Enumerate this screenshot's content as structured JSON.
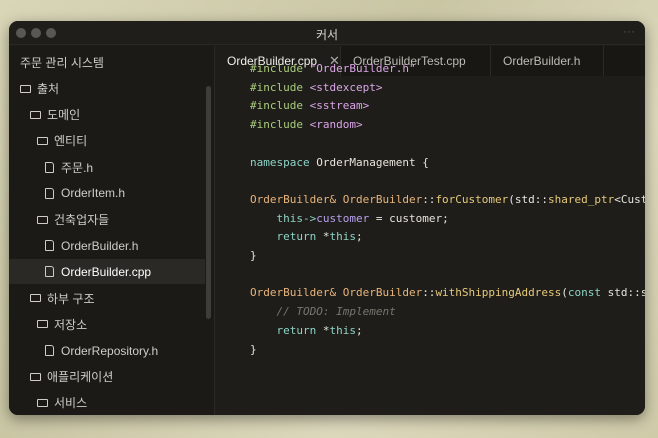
{
  "window": {
    "title": "커서"
  },
  "sidebar": {
    "header": "주문 관리 시스템",
    "items": [
      {
        "label": "출처",
        "type": "folder",
        "level": 0
      },
      {
        "label": "도메인",
        "type": "folder",
        "level": 1
      },
      {
        "label": "엔티티",
        "type": "folder",
        "level": 2
      },
      {
        "label": "주문.h",
        "type": "file",
        "level": 3
      },
      {
        "label": "OrderItem.h",
        "type": "file",
        "level": 3
      },
      {
        "label": "건축업자들",
        "type": "folder",
        "level": 2
      },
      {
        "label": "OrderBuilder.h",
        "type": "file",
        "level": 3
      },
      {
        "label": "OrderBuilder.cpp",
        "type": "file",
        "level": 3,
        "selected": true
      },
      {
        "label": "하부 구조",
        "type": "folder",
        "level": 1
      },
      {
        "label": "저장소",
        "type": "folder",
        "level": 2
      },
      {
        "label": "OrderRepository.h",
        "type": "file",
        "level": 3
      },
      {
        "label": "애플리케이션",
        "type": "folder",
        "level": 1
      },
      {
        "label": "서비스",
        "type": "folder",
        "level": 2
      }
    ]
  },
  "tabs": [
    {
      "label": "OrderBuilder.cpp",
      "active": true
    },
    {
      "label": "OrderBuilderTest.cpp"
    },
    {
      "label": "OrderBuilder.h"
    }
  ],
  "code": [
    [
      [
        "inc",
        "#include "
      ],
      [
        "str",
        "\"OrderBuilder.h\""
      ]
    ],
    [
      [
        "inc",
        "#include "
      ],
      [
        "str",
        "<stdexcept>"
      ]
    ],
    [
      [
        "inc",
        "#include "
      ],
      [
        "str",
        "<sstream>"
      ]
    ],
    [
      [
        "inc",
        "#include "
      ],
      [
        "str",
        "<random>"
      ]
    ],
    [],
    [
      [
        "kw",
        "namespace "
      ],
      [
        "",
        "OrderManagement {"
      ]
    ],
    [],
    [
      [
        "ty",
        "OrderBuilder& OrderBuilder"
      ],
      [
        "",
        "::"
      ],
      [
        "fn",
        "forCustomer"
      ],
      [
        "",
        "(std::"
      ],
      [
        "fn",
        "shared_ptr"
      ],
      [
        "",
        "<Customer> customer) {"
      ]
    ],
    [
      [
        "",
        "    "
      ],
      [
        "kw",
        "this->"
      ],
      [
        "mem",
        "customer"
      ],
      [
        "",
        " = customer;"
      ]
    ],
    [
      [
        "",
        "    "
      ],
      [
        "kw",
        "return "
      ],
      [
        "",
        "*"
      ],
      [
        "kw",
        "this"
      ],
      [
        "",
        ";"
      ]
    ],
    [
      [
        "",
        "}"
      ]
    ],
    [],
    [
      [
        "ty",
        "OrderBuilder& OrderBuilder"
      ],
      [
        "",
        "::"
      ],
      [
        "fn",
        "withShippingAddress"
      ],
      [
        "",
        "("
      ],
      [
        "kw",
        "const "
      ],
      [
        "",
        "std::string& address) {"
      ]
    ],
    [
      [
        "",
        "    "
      ],
      [
        "cm",
        "// TODO: Implement"
      ]
    ],
    [
      [
        "",
        "    "
      ],
      [
        "kw",
        "return "
      ],
      [
        "",
        "*"
      ],
      [
        "kw",
        "this"
      ],
      [
        "",
        ";"
      ]
    ],
    [
      [
        "",
        "}"
      ]
    ]
  ]
}
